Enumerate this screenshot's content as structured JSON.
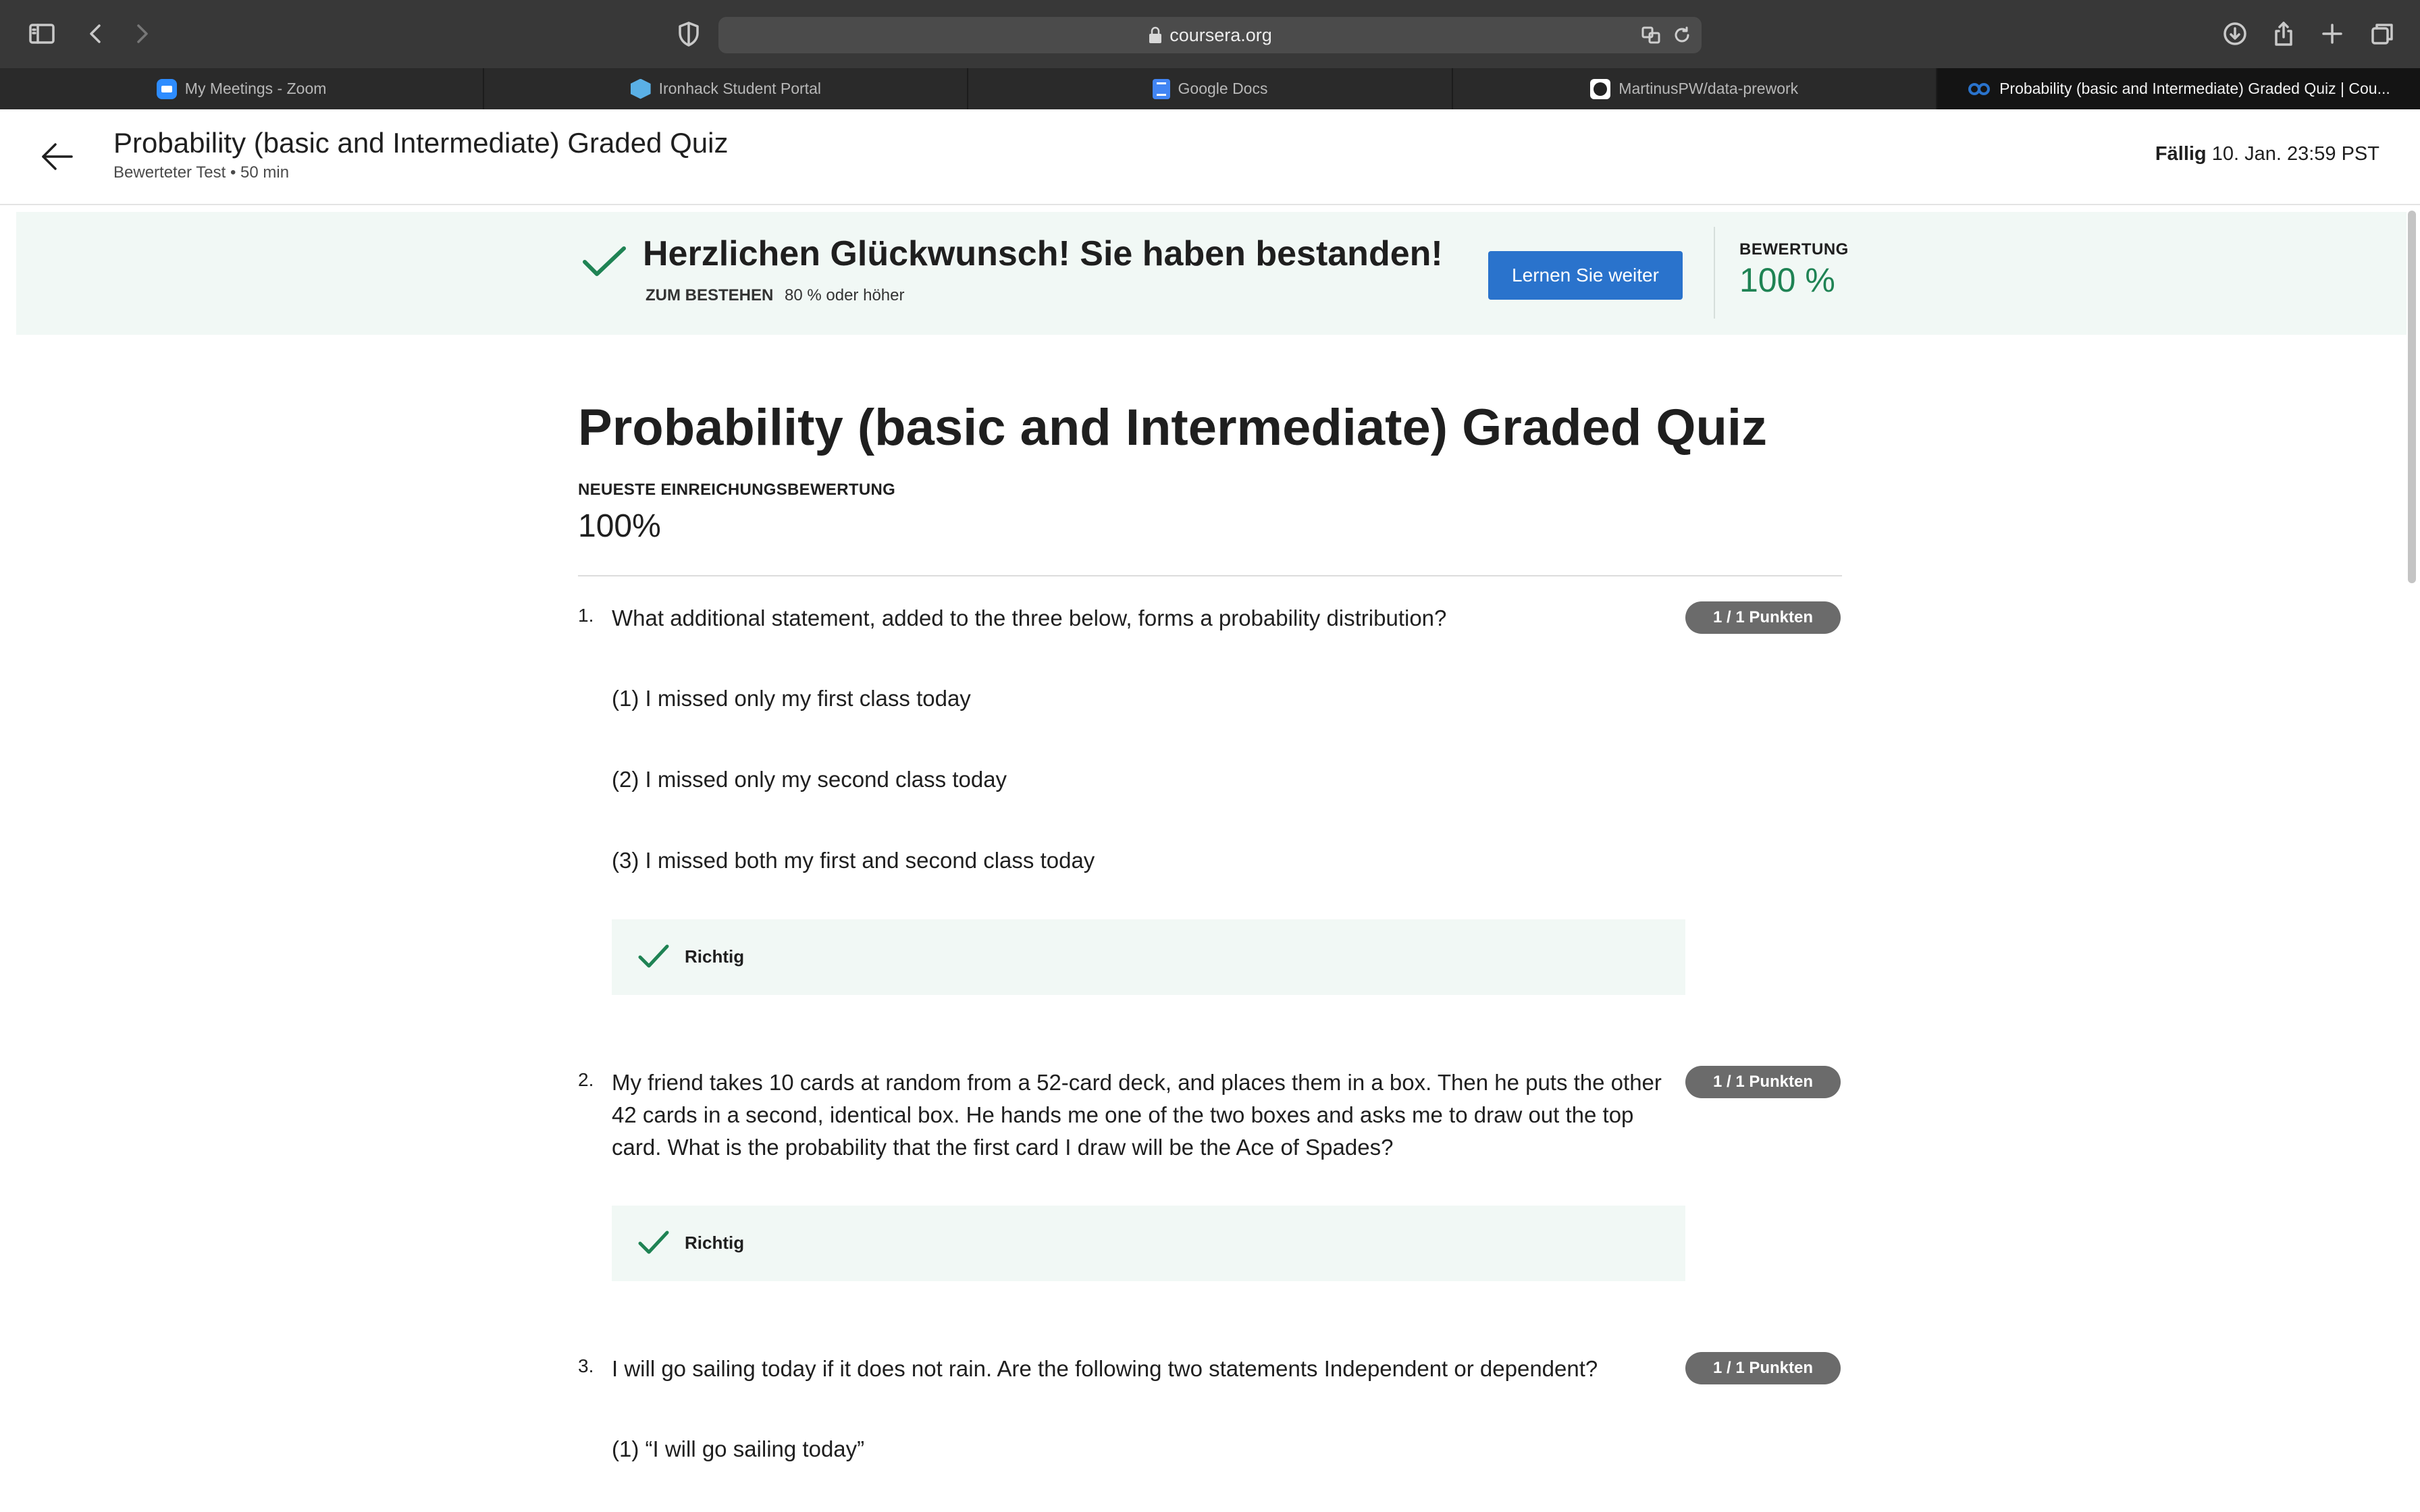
{
  "browser": {
    "url": "coursera.org",
    "tabs": [
      {
        "label": "My Meetings - Zoom",
        "icon": "zoom-icon",
        "active": false
      },
      {
        "label": "Ironhack Student Portal",
        "icon": "ironhack-icon",
        "active": false
      },
      {
        "label": "Google Docs",
        "icon": "google-docs-icon",
        "active": false
      },
      {
        "label": "MartinusPW/data-prework",
        "icon": "github-icon",
        "active": false
      },
      {
        "label": "Probability (basic and Intermediate) Graded Quiz | Cou...",
        "icon": "coursera-icon",
        "active": true
      }
    ]
  },
  "header": {
    "title": "Probability (basic and Intermediate) Graded Quiz",
    "subtitle": "Bewerteter Test • 50 min",
    "due_label": "Fällig",
    "due_value": "10. Jan. 23:59 PST"
  },
  "banner": {
    "title": "Herzlichen Glückwunsch! Sie haben bestanden!",
    "pass_label": "ZUM BESTEHEN",
    "pass_value": "80 % oder höher",
    "button_label": "Lernen Sie weiter",
    "grade_label": "BEWERTUNG",
    "grade_value": "100 %"
  },
  "main": {
    "title": "Probability (basic and Intermediate) Graded Quiz",
    "latest_label": "NEUESTE EINREICHUNGSBEWERTUNG",
    "latest_value": "100%",
    "questions": [
      {
        "number": "1.",
        "text": "What additional statement, added to the three below, forms a probability distribution?",
        "points": "1 / 1 Punkten",
        "options": [
          "(1) I missed only my first class today",
          "(2) I missed only my second class today",
          "(3) I missed both my first and second class today"
        ],
        "result": "Richtig"
      },
      {
        "number": "2.",
        "text": "My friend takes 10 cards at random from a 52-card deck, and places them in a box. Then he puts the other 42 cards in a second, identical box. He hands me one of the two boxes and asks me to draw out the top card. What is the probability that the first card I draw will be the Ace of Spades?",
        "points": "1 / 1 Punkten",
        "options": [],
        "result": "Richtig"
      },
      {
        "number": "3.",
        "text": "I will go sailing today if it does not rain. Are the following two statements Independent or dependent?",
        "points": "1 / 1 Punkten",
        "options": [
          "(1) “I will go sailing today”"
        ]
      }
    ]
  },
  "colors": {
    "accent": "#2a73cc",
    "success": "#1f8354",
    "banner_bg": "#f1f8f5",
    "badge_bg": "#6b6b6b"
  }
}
